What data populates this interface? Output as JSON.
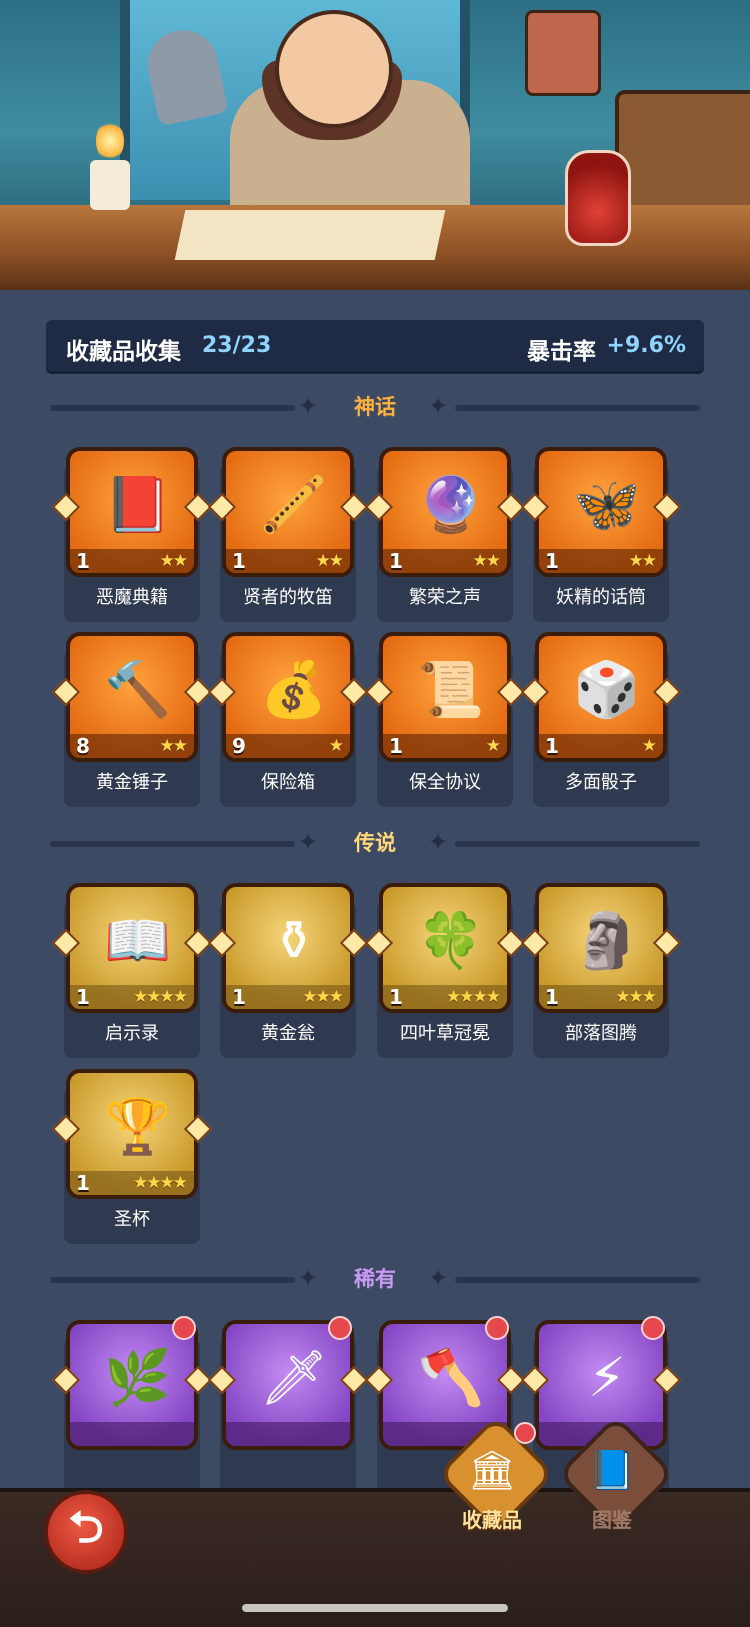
{
  "header": {
    "title": "收藏品收集",
    "count": "23/23",
    "crit_label": "暴击率",
    "crit_value": "+9.6%"
  },
  "sections": [
    {
      "key": "mythic",
      "label": "神话",
      "label_color": "#ffb13b",
      "items": [
        {
          "name": "恶魔典籍",
          "level": "1",
          "stars": "★★",
          "icon": "demon-book-icon",
          "glyph": "📕"
        },
        {
          "name": "贤者的牧笛",
          "level": "1",
          "stars": "★★",
          "icon": "sage-flute-icon",
          "glyph": "🪈"
        },
        {
          "name": "繁荣之声",
          "level": "1",
          "stars": "★★",
          "icon": "prosperity-orb-icon",
          "glyph": "🔮"
        },
        {
          "name": "妖精的话筒",
          "level": "1",
          "stars": "★★",
          "icon": "fairy-megaphone-icon",
          "glyph": "🦋"
        },
        {
          "name": "黄金锤子",
          "level": "8",
          "stars": "★★",
          "icon": "golden-hammer-icon",
          "glyph": "🔨"
        },
        {
          "name": "保险箱",
          "level": "9",
          "stars": "★",
          "icon": "treasure-chest-icon",
          "glyph": "💰"
        },
        {
          "name": "保全协议",
          "level": "1",
          "stars": "★",
          "icon": "scroll-contract-icon",
          "glyph": "📜"
        },
        {
          "name": "多面骰子",
          "level": "1",
          "stars": "★",
          "icon": "polyhedral-dice-icon",
          "glyph": "🎲"
        }
      ]
    },
    {
      "key": "legendary",
      "label": "传说",
      "label_color": "#ffd87a",
      "items": [
        {
          "name": "启示录",
          "level": "1",
          "stars": "★★★★",
          "icon": "open-book-icon",
          "glyph": "📖"
        },
        {
          "name": "黄金瓮",
          "level": "1",
          "stars": "★★★",
          "icon": "golden-urn-icon",
          "glyph": "⚱"
        },
        {
          "name": "四叶草冠冕",
          "level": "1",
          "stars": "★★★★",
          "icon": "clover-crown-icon",
          "glyph": "🍀"
        },
        {
          "name": "部落图腾",
          "level": "1",
          "stars": "★★★",
          "icon": "tribal-totem-icon",
          "glyph": "🗿"
        },
        {
          "name": "圣杯",
          "level": "1",
          "stars": "★★★★",
          "icon": "holy-grail-icon",
          "glyph": "🏆"
        }
      ]
    },
    {
      "key": "rare",
      "label": "稀有",
      "label_color": "#c99af5",
      "items": [
        {
          "name": "",
          "level": "",
          "stars": "",
          "icon": "thorn-vines-icon",
          "glyph": "🌿",
          "badge": true
        },
        {
          "name": "",
          "level": "",
          "stars": "",
          "icon": "ice-dagger-icon",
          "glyph": "🗡",
          "badge": true
        },
        {
          "name": "",
          "level": "",
          "stars": "",
          "icon": "battle-axe-icon",
          "glyph": "🪓",
          "badge": true
        },
        {
          "name": "",
          "level": "",
          "stars": "",
          "icon": "lightning-card-icon",
          "glyph": "⚡",
          "badge": true
        }
      ]
    }
  ],
  "bottom_nav": {
    "back_icon": "back-arrow-icon",
    "tabs": [
      {
        "label": "收藏品",
        "icon": "collection-icon",
        "glyph": "🏛",
        "active": true,
        "badge": true
      },
      {
        "label": "图鉴",
        "icon": "codex-book-icon",
        "glyph": "📘",
        "active": false,
        "badge": false
      }
    ]
  }
}
